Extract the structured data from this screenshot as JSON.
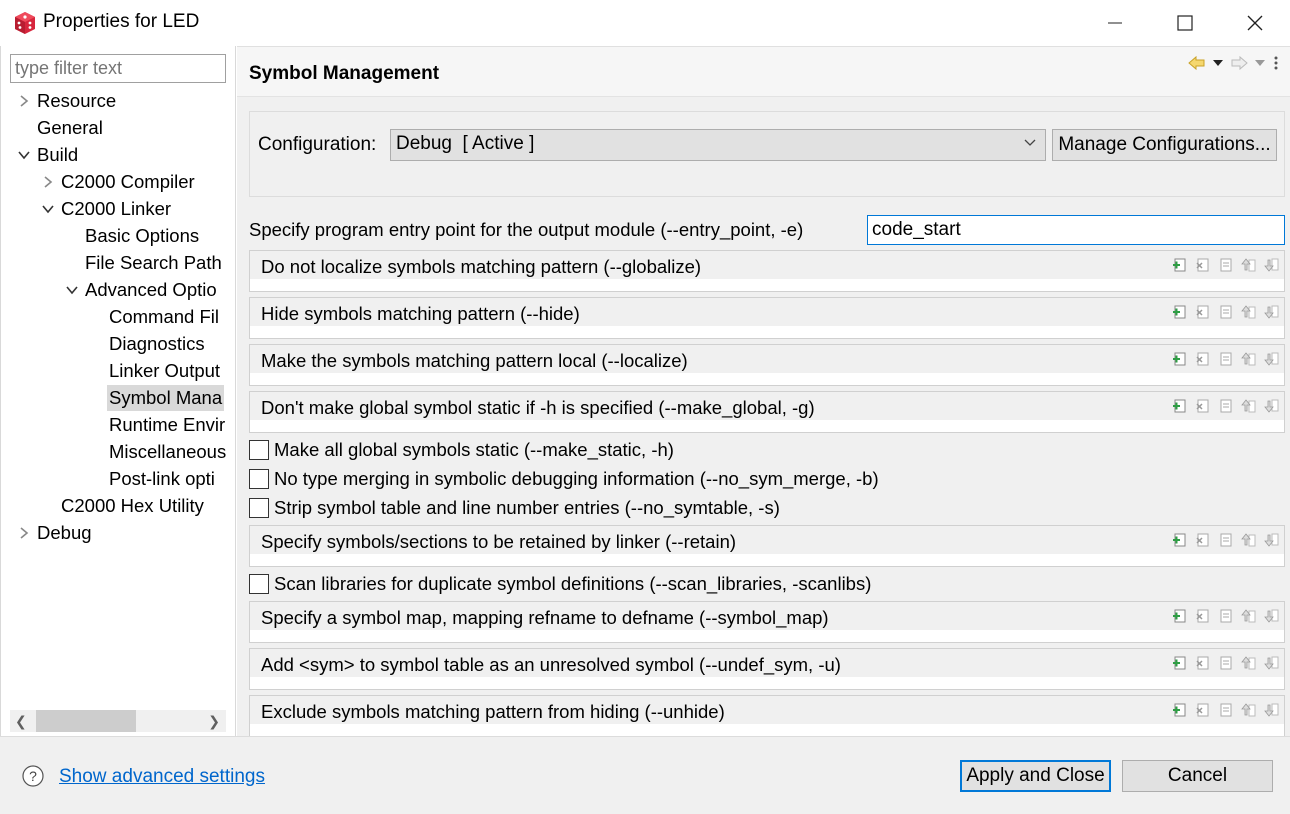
{
  "window": {
    "title": "Properties for LED"
  },
  "left": {
    "filter_placeholder": "type filter text",
    "tree": [
      {
        "label": "Resource",
        "level": 0,
        "arrow": "right"
      },
      {
        "label": "General",
        "level": 0,
        "arrow": "none"
      },
      {
        "label": "Build",
        "level": 0,
        "arrow": "down"
      },
      {
        "label": "C2000 Compiler",
        "level": 1,
        "arrow": "right"
      },
      {
        "label": "C2000 Linker",
        "level": 1,
        "arrow": "down"
      },
      {
        "label": "Basic Options",
        "level": 2,
        "arrow": "none"
      },
      {
        "label": "File Search Path",
        "level": 2,
        "arrow": "none"
      },
      {
        "label": "Advanced Optio",
        "level": 2,
        "arrow": "down"
      },
      {
        "label": "Command Fil",
        "level": 3,
        "arrow": "none"
      },
      {
        "label": "Diagnostics",
        "level": 3,
        "arrow": "none"
      },
      {
        "label": "Linker Output",
        "level": 3,
        "arrow": "none"
      },
      {
        "label": "Symbol Mana",
        "level": 3,
        "arrow": "none",
        "selected": true
      },
      {
        "label": "Runtime Envir",
        "level": 3,
        "arrow": "none"
      },
      {
        "label": "Miscellaneous",
        "level": 3,
        "arrow": "none"
      },
      {
        "label": "Post-link opti",
        "level": 3,
        "arrow": "none"
      },
      {
        "label": "C2000 Hex Utility",
        "level": 1,
        "arrow": "none"
      },
      {
        "label": "Debug",
        "level": 0,
        "arrow": "right"
      }
    ]
  },
  "right": {
    "title": "Symbol Management",
    "config_label": "Configuration:",
    "config_value": "Debug  [ Active ]",
    "manage_label": "Manage Configurations...",
    "entry_label": "Specify program entry point for the output module (--entry_point, -e)",
    "entry_value": "code_start",
    "groups": [
      "Do not localize symbols matching pattern (--globalize)",
      "Hide symbols matching pattern (--hide)",
      "Make the symbols matching pattern local (--localize)",
      "Don't make global symbol static if -h is specified (--make_global, -g)"
    ],
    "checks": [
      "Make all global symbols static (--make_static, -h)",
      "No type merging in symbolic debugging information (--no_sym_merge, -b)",
      "Strip symbol table and line number entries (--no_symtable, -s)"
    ],
    "group_retain": "Specify symbols/sections to be retained by linker (--retain)",
    "check_scan": "Scan libraries for duplicate symbol definitions (--scan_libraries, -scanlibs)",
    "groups2": [
      "Specify a symbol map, mapping refname to defname (--symbol_map)",
      "Add <sym> to symbol table as an unresolved symbol (--undef_sym, -u)",
      "Exclude symbols matching pattern from hiding (--unhide)"
    ]
  },
  "bottom": {
    "advanced_link": "Show advanced settings",
    "apply_label": "Apply and Close",
    "cancel_label": "Cancel"
  },
  "colors": {
    "accent": "#0078d7",
    "link": "#0066cc",
    "app_icon": "#d7263d"
  }
}
